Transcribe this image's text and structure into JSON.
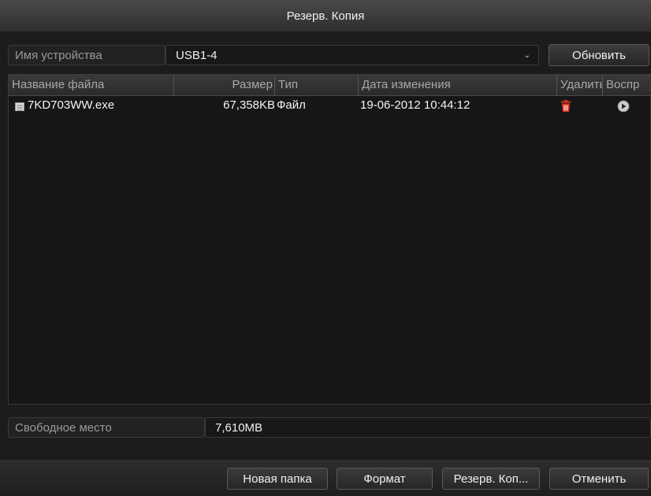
{
  "dialog": {
    "title": "Резерв. Копия"
  },
  "device": {
    "label": "Имя устройства",
    "selected": "USB1-4",
    "refresh_label": "Обновить"
  },
  "table": {
    "columns": {
      "name": "Название файла",
      "size": "Размер",
      "type": "Тип",
      "modified": "Дата изменения",
      "delete": "Удалить",
      "play": "Воспр"
    },
    "rows": [
      {
        "name": "7KD703WW.exe",
        "size": "67,358KB",
        "type": "Файл",
        "modified": "19-06-2012 10:44:12"
      }
    ]
  },
  "free_space": {
    "label": "Свободное место",
    "value": "7,610MB"
  },
  "buttons": {
    "new_folder": "Новая папка",
    "format": "Формат",
    "backup": "Резерв. Коп...",
    "cancel": "Отменить"
  },
  "colors": {
    "delete_icon": "#e0301e",
    "accent": "#2e2e2e"
  }
}
